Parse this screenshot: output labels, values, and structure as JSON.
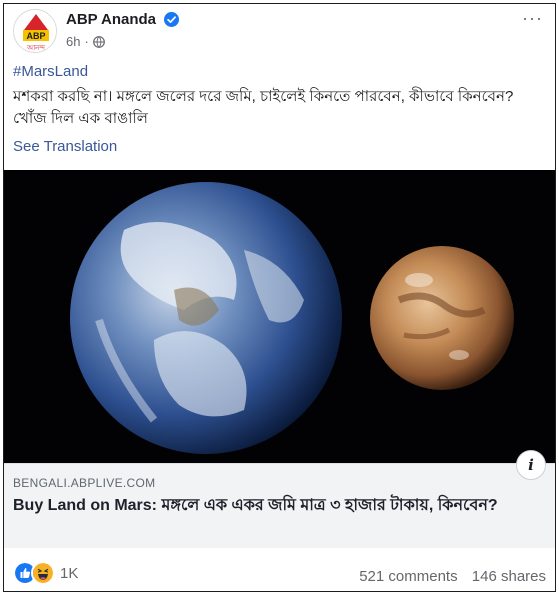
{
  "post": {
    "page_name": "ABP Ananda",
    "time": "6h",
    "time_separator": "·",
    "hashtag": "#MarsLand",
    "text": "মশকরা করছি না। মঙ্গলে জলের দরে জমি, চাইলেই কিনতে পারবেন, কীভাবে কিনবেন? খোঁজ দিল এক বাঙালি",
    "see_translation": "See Translation",
    "more_label": "···"
  },
  "avatar": {
    "brand": "ABP",
    "subtext": "আনন্দ"
  },
  "link": {
    "domain": "BENGALI.ABPLIVE.COM",
    "title": "Buy Land on Mars: মঙ্গলে এক একর জমি মাত্র ৩ হাজার টাকায়, কিনবেন?",
    "info_label": "i"
  },
  "footer": {
    "reaction_count": "1K",
    "comments": "521 comments",
    "shares": "146 shares"
  },
  "colors": {
    "link_blue": "#385898",
    "brand_red": "#d6242a",
    "like_blue": "#1877f2",
    "haha_yellow": "#f7b125"
  },
  "icons": [
    "verified-badge-icon",
    "globe-icon",
    "more-options-icon",
    "info-icon",
    "like-reaction-icon",
    "haha-reaction-icon"
  ]
}
